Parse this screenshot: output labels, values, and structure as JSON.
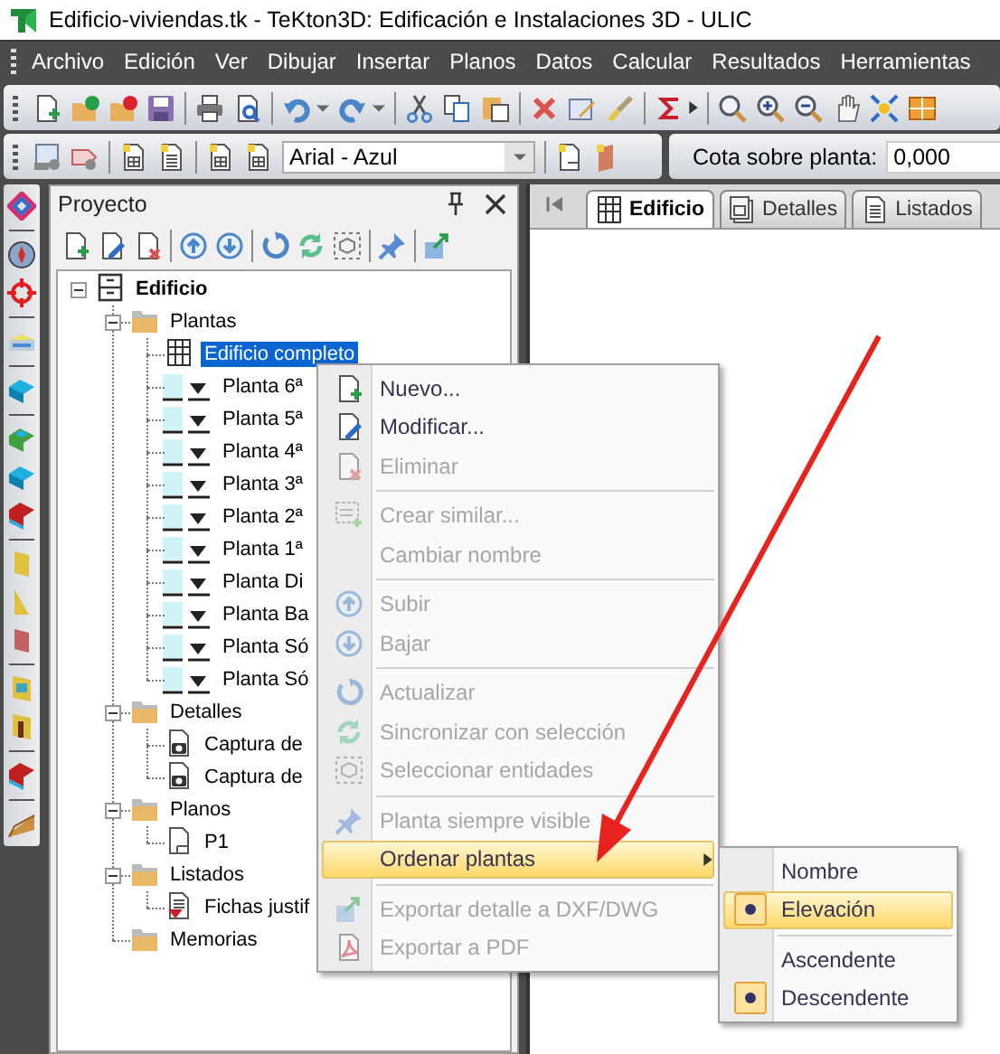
{
  "window": {
    "title": "Edificio-viviendas.tk - TeKton3D: Edificación e Instalaciones 3D - ULIC"
  },
  "menu_bar": [
    "Archivo",
    "Edición",
    "Ver",
    "Dibujar",
    "Insertar",
    "Planos",
    "Datos",
    "Calcular",
    "Resultados",
    "Herramientas"
  ],
  "toolbar": {
    "style_dropdown": "Arial - Azul",
    "elevation_label": "Cota sobre planta:",
    "elevation_value": "0,000"
  },
  "project_panel": {
    "title": "Proyecto",
    "tree": [
      {
        "label": "Edificio",
        "kind": "root",
        "expanded": true,
        "selected": false,
        "children": [
          {
            "label": "Plantas",
            "kind": "folder",
            "expanded": true,
            "selected": false,
            "children": [
              {
                "label": "Edificio completo",
                "kind": "view",
                "selected": true
              },
              {
                "label": "Planta 6ª",
                "kind": "level",
                "selected": false
              },
              {
                "label": "Planta 5ª",
                "kind": "level",
                "selected": false
              },
              {
                "label": "Planta 4ª",
                "kind": "level",
                "selected": false
              },
              {
                "label": "Planta 3ª",
                "kind": "level",
                "selected": false
              },
              {
                "label": "Planta 2ª",
                "kind": "level",
                "selected": false
              },
              {
                "label": "Planta 1ª",
                "kind": "level",
                "selected": false
              },
              {
                "label": "Planta Di",
                "kind": "level",
                "selected": false
              },
              {
                "label": "Planta Ba",
                "kind": "level",
                "selected": false
              },
              {
                "label": "Planta Só",
                "kind": "level",
                "selected": false
              },
              {
                "label": "Planta Só",
                "kind": "level",
                "selected": false
              }
            ]
          },
          {
            "label": "Detalles",
            "kind": "folder",
            "expanded": true,
            "selected": false,
            "children": [
              {
                "label": "Captura de",
                "kind": "capture",
                "selected": false
              },
              {
                "label": "Captura de",
                "kind": "capture",
                "selected": false
              }
            ]
          },
          {
            "label": "Planos",
            "kind": "folder",
            "expanded": true,
            "selected": false,
            "children": [
              {
                "label": "P1",
                "kind": "sheet",
                "selected": false
              }
            ]
          },
          {
            "label": "Listados",
            "kind": "folder",
            "expanded": true,
            "selected": false,
            "children": [
              {
                "label": "Fichas justif",
                "kind": "report",
                "selected": false
              }
            ]
          },
          {
            "label": "Memorias",
            "kind": "folder",
            "selected": false
          }
        ]
      }
    ]
  },
  "document_tabs": [
    {
      "label": "Edificio",
      "selected": true
    },
    {
      "label": "Detalles",
      "selected": false
    },
    {
      "label": "Listados",
      "selected": false
    }
  ],
  "context_menu": [
    {
      "kind": "item",
      "label": "Nuevo...",
      "disabled": false,
      "highlighted": false,
      "has_submenu": false
    },
    {
      "kind": "item",
      "label": "Modificar...",
      "disabled": false,
      "highlighted": false,
      "has_submenu": false
    },
    {
      "kind": "item",
      "label": "Eliminar",
      "disabled": true,
      "highlighted": false,
      "has_submenu": false
    },
    {
      "kind": "separator"
    },
    {
      "kind": "item",
      "label": "Crear similar...",
      "disabled": true,
      "highlighted": false,
      "has_submenu": false
    },
    {
      "kind": "item",
      "label": "Cambiar nombre",
      "disabled": true,
      "highlighted": false,
      "has_submenu": false
    },
    {
      "kind": "separator"
    },
    {
      "kind": "item",
      "label": "Subir",
      "disabled": true,
      "highlighted": false,
      "has_submenu": false
    },
    {
      "kind": "item",
      "label": "Bajar",
      "disabled": true,
      "highlighted": false,
      "has_submenu": false
    },
    {
      "kind": "separator"
    },
    {
      "kind": "item",
      "label": "Actualizar",
      "disabled": true,
      "highlighted": false,
      "has_submenu": false
    },
    {
      "kind": "item",
      "label": "Sincronizar con selección",
      "disabled": true,
      "highlighted": false,
      "has_submenu": false
    },
    {
      "kind": "item",
      "label": "Seleccionar entidades",
      "disabled": true,
      "highlighted": false,
      "has_submenu": false
    },
    {
      "kind": "separator"
    },
    {
      "kind": "item",
      "label": "Planta siempre visible",
      "disabled": true,
      "highlighted": false,
      "has_submenu": false
    },
    {
      "kind": "item",
      "label": "Ordenar plantas",
      "disabled": false,
      "highlighted": true,
      "has_submenu": true
    },
    {
      "kind": "separator"
    },
    {
      "kind": "item",
      "label": "Exportar detalle a DXF/DWG",
      "disabled": true,
      "highlighted": false,
      "has_submenu": false
    },
    {
      "kind": "item",
      "label": "Exportar a PDF",
      "disabled": true,
      "highlighted": false,
      "has_submenu": false
    }
  ],
  "submenu": [
    {
      "kind": "item",
      "label": "Nombre",
      "selected": false,
      "highlighted": false
    },
    {
      "kind": "item",
      "label": "Elevación",
      "selected": true,
      "highlighted": true
    },
    {
      "kind": "separator"
    },
    {
      "kind": "item",
      "label": "Ascendente",
      "selected": false,
      "highlighted": false
    },
    {
      "kind": "item",
      "label": "Descendente",
      "selected": true,
      "highlighted": false
    }
  ]
}
